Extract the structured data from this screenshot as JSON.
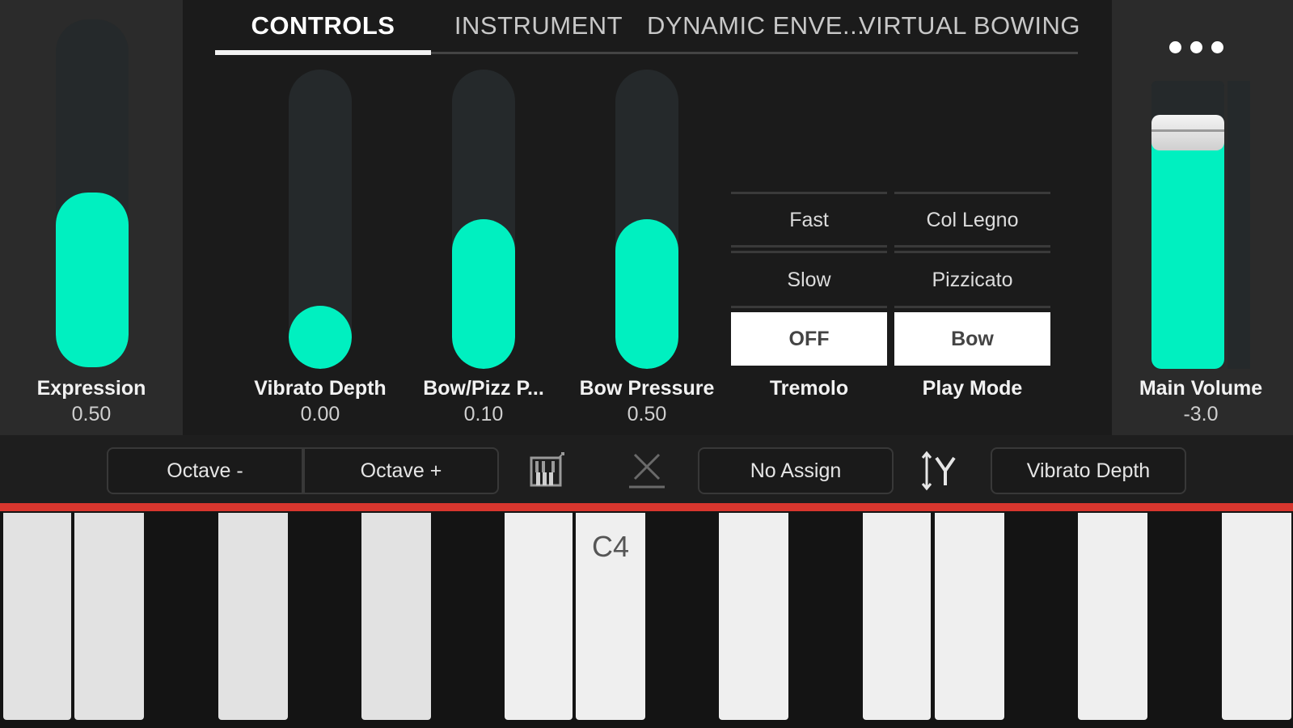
{
  "tabs": [
    {
      "label": "CONTROLS",
      "active": true
    },
    {
      "label": "INSTRUMENT",
      "active": false
    },
    {
      "label": "DYNAMIC ENVE...",
      "active": false
    },
    {
      "label": "VIRTUAL BOWING",
      "active": false
    }
  ],
  "sliders": {
    "expression": {
      "label": "Expression",
      "value": "0.50",
      "level": 0.5
    },
    "vibrato_depth": {
      "label": "Vibrato Depth",
      "value": "0.00",
      "level": 0.0
    },
    "bow_pizz": {
      "label": "Bow/Pizz P...",
      "value": "0.10",
      "level": 0.5
    },
    "bow_pressure": {
      "label": "Bow Pressure",
      "value": "0.50",
      "level": 0.5
    }
  },
  "tremolo": {
    "label": "Tremolo",
    "options": [
      "Fast",
      "Slow",
      "OFF"
    ],
    "selected": "OFF"
  },
  "play_mode": {
    "label": "Play Mode",
    "options": [
      "Col Legno",
      "Pizzicato",
      "Bow"
    ],
    "selected": "Bow"
  },
  "main_volume": {
    "label": "Main Volume",
    "value": "-3.0",
    "level": 0.86
  },
  "more_menu": {
    "icon": "more-dots-icon"
  },
  "toolbar": {
    "octave_down": "Octave -",
    "octave_up": "Octave +",
    "keyboard_icon": "keyboard-icon",
    "x_axis_icon": "x-axis-icon",
    "x_assign": "No Assign",
    "y_axis_icon": "y-axis-icon",
    "y_assign": "Vibrato Depth"
  },
  "keyboard": {
    "c4_label": "C4"
  },
  "colors": {
    "accent": "#00f0c0",
    "keyboard_line": "#d8362e",
    "panel": "#2b2b2b",
    "background": "#1b1b1b"
  }
}
